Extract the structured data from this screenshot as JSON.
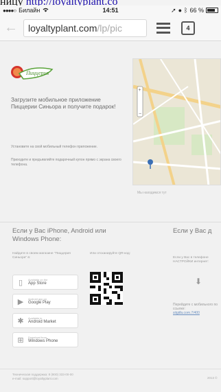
{
  "overlay": {
    "text_before": "ницу ",
    "link": "http://loyaltyplant.co"
  },
  "status_bar": {
    "carrier": "Билайн",
    "time": "14:51",
    "battery": "66 %"
  },
  "browser": {
    "url_host": "loyaltyplant.com",
    "url_path": "/lp/pic",
    "tabs_count": "4"
  },
  "page": {
    "logo_text": "Пиццерия",
    "promo_text": "Загрузите мобильное приложение Пиццерии Синьора и получите подарок!",
    "bullets": [
      "Установите на свой мобильный телефон приложение.",
      "Приходите и предъявляйте подарочный купон прямо с экрана своего телефона."
    ],
    "map_caption": "Мы находимся тут",
    "iphone_title": "Если у Вас iPhone, Android или Windows Phone:",
    "other_title": "Если у Вас д",
    "store_note": "Найдите в своем магазине \"Пиццерия Синьора\" в:",
    "qr_note": "Или отсканируйте QR-код:",
    "other_note": "Если у Вас в телефоне НАСТРОЙКИ интернет:",
    "stores": [
      {
        "sup": "Available on the",
        "name": "App Store",
        "icon": "phone-icon"
      },
      {
        "sup": "Android app on",
        "name": "Google Play",
        "icon": "play-icon"
      },
      {
        "sup": "Available in",
        "name": "Android Market",
        "icon": "android-icon"
      },
      {
        "sup": "Download from",
        "name": "Windows Phone",
        "icon": "windows-icon"
      }
    ],
    "download_note": "Перейдите с мобильного по ссылке:",
    "download_link": "sitgiifa.com.7/400",
    "footer_line1": "Техническая поддержка: 8 (800) 333-00-00",
    "footer_line2": "e-mail: support@loyaltyplant.com",
    "footer_right": "2013 ©"
  }
}
